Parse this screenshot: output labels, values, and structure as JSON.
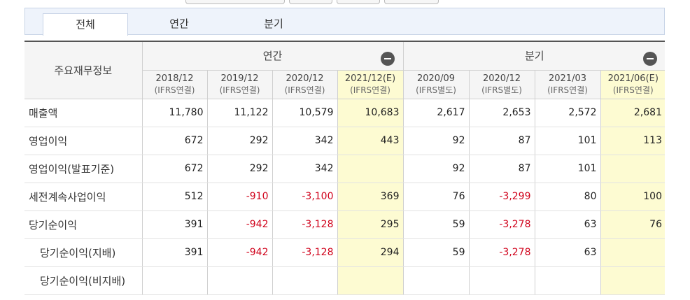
{
  "tabs": [
    {
      "label": "전체"
    },
    {
      "label": "연간"
    },
    {
      "label": "분기"
    }
  ],
  "table": {
    "row_header": "주요재무정보",
    "groups": [
      {
        "label": "연간"
      },
      {
        "label": "분기"
      }
    ],
    "columns": [
      {
        "period": "2018/12",
        "basis": "(IFRS연결)"
      },
      {
        "period": "2019/12",
        "basis": "(IFRS연결)"
      },
      {
        "period": "2020/12",
        "basis": "(IFRS연결)"
      },
      {
        "period": "2021/12(E)",
        "basis": "(IFRS연결)"
      },
      {
        "period": "2020/09",
        "basis": "(IFRS별도)"
      },
      {
        "period": "2020/12",
        "basis": "(IFRS별도)"
      },
      {
        "period": "2021/03",
        "basis": "(IFRS연결)"
      },
      {
        "period": "2021/06(E)",
        "basis": "(IFRS연결)"
      }
    ],
    "rows": [
      {
        "label": "매출액",
        "values": [
          "11,780",
          "11,122",
          "10,579",
          "10,683",
          "2,617",
          "2,653",
          "2,572",
          "2,681"
        ]
      },
      {
        "label": "영업이익",
        "values": [
          "672",
          "292",
          "342",
          "443",
          "92",
          "87",
          "101",
          "113"
        ]
      },
      {
        "label": "영업이익(발표기준)",
        "values": [
          "672",
          "292",
          "342",
          "",
          "92",
          "87",
          "101",
          ""
        ]
      },
      {
        "label": "세전계속사업이익",
        "values": [
          "512",
          "-910",
          "-3,100",
          "369",
          "76",
          "-3,299",
          "80",
          "100"
        ]
      },
      {
        "label": "당기순이익",
        "values": [
          "391",
          "-942",
          "-3,128",
          "295",
          "59",
          "-3,278",
          "63",
          "76"
        ]
      },
      {
        "label": "당기순이익(지배)",
        "values": [
          "391",
          "-942",
          "-3,128",
          "294",
          "59",
          "-3,278",
          "63",
          ""
        ]
      },
      {
        "label": "당기순이익(비지배)",
        "values": [
          "",
          "",
          "",
          "",
          "",
          "",
          "",
          ""
        ]
      }
    ]
  },
  "colors": {
    "estimate_bg": "#fdfbd2",
    "negative": "#d0021b",
    "tab_bg": "#eef3fb"
  }
}
